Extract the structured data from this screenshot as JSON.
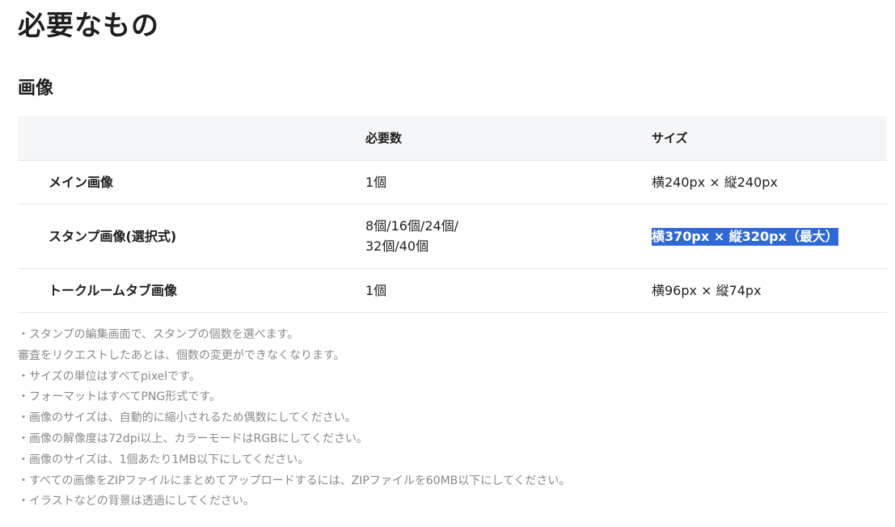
{
  "page": {
    "title": "必要なもの"
  },
  "section": {
    "title": "画像"
  },
  "table": {
    "headers": [
      "",
      "必要数",
      "サイズ"
    ],
    "rows": [
      {
        "name": "メイン画像",
        "count": "1個",
        "size": "横240px × 縦240px"
      },
      {
        "name": "スタンプ画像(選択式)",
        "count_line1": "8個/16個/24個/",
        "count_line2": "32個/40個",
        "size": "横370px × 縦320px（最大）"
      },
      {
        "name": "トークルームタブ画像",
        "count": "1個",
        "size": "横96px × 縦74px"
      }
    ]
  },
  "notes": [
    "・スタンプの編集画面で、スタンプの個数を選べます。",
    "審査をリクエストしたあとは、個数の変更ができなくなります。",
    "・サイズの単位はすべてpixelです。",
    "・フォーマットはすべてPNG形式です。",
    "・画像のサイズは、自動的に縮小されるため偶数にしてください。",
    "・画像の解像度は72dpi以上、カラーモードはRGBにしてください。",
    "・画像のサイズは、1個あたり1MB以下にしてください。",
    "・すべての画像をZIPファイルにまとめてアップロードするには、ZIPファイルを60MB以下にしてください。",
    "・イラストなどの背景は透過にしてください。"
  ],
  "colors": {
    "highlight": "#2f69d6",
    "header_bg": "#f5f6f7",
    "note_text": "#8a8a8a"
  }
}
